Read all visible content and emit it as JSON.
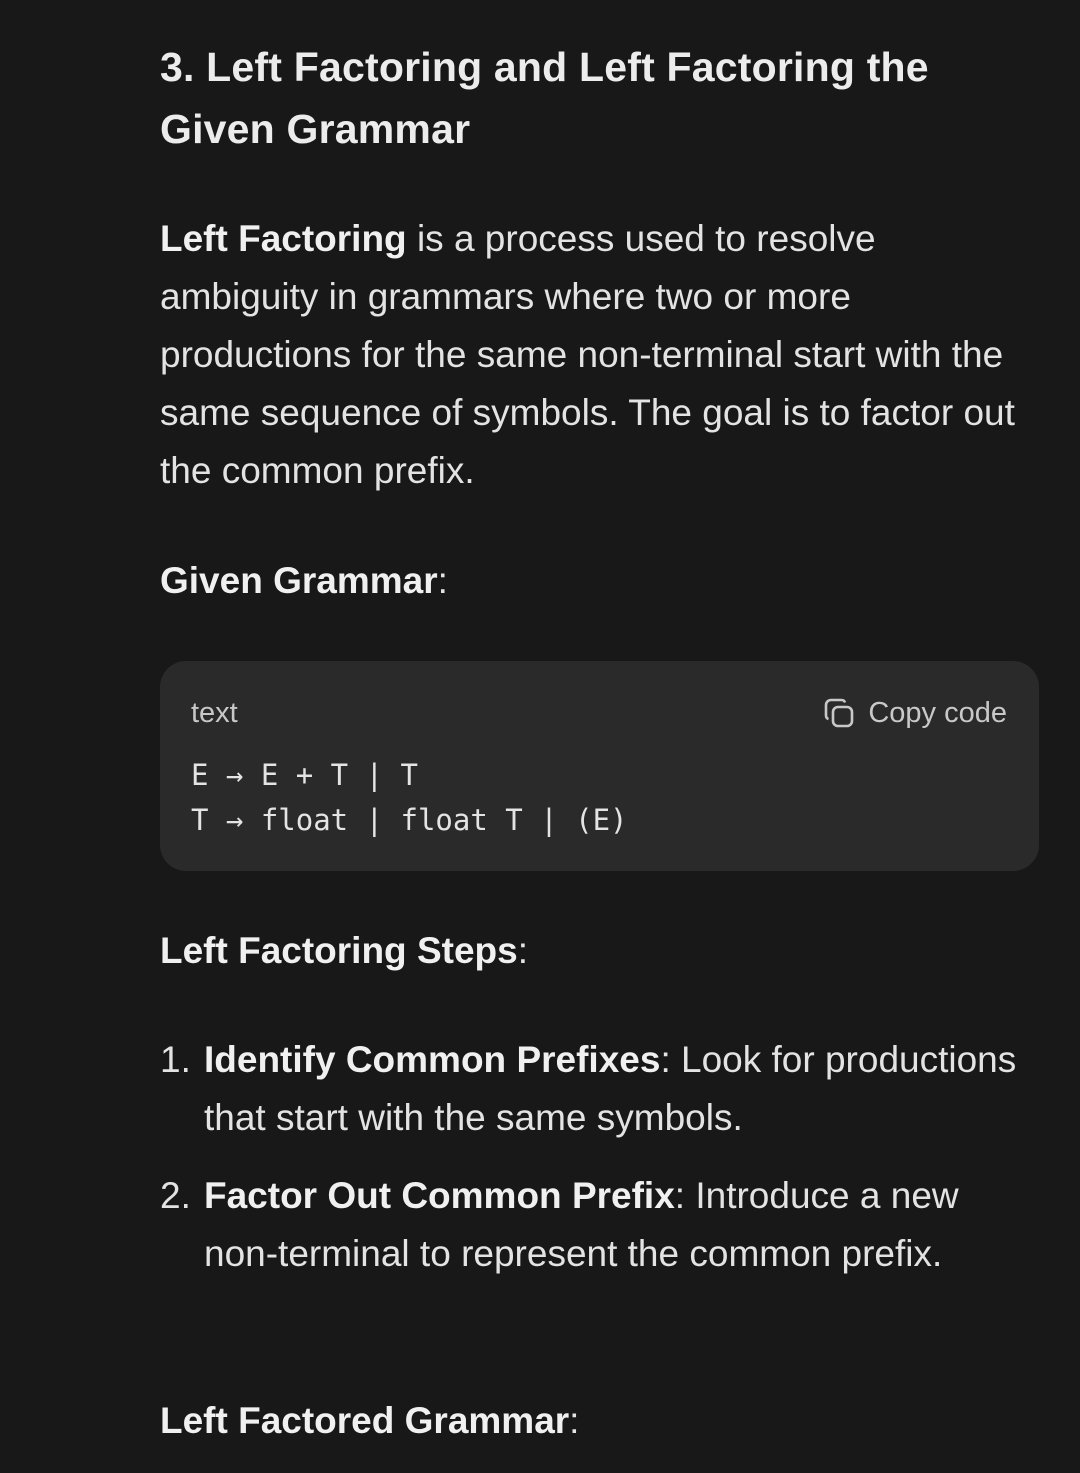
{
  "section": {
    "heading": "3. Left Factoring and Left Factoring the Given Grammar"
  },
  "intro": {
    "term": "Left Factoring",
    "text": " is a process used to resolve ambiguity in grammars where two or more productions for the same non-terminal start with the same sequence of symbols. The goal is to factor out the common prefix."
  },
  "given_grammar": {
    "label": "Given Grammar",
    "colon": ":"
  },
  "code_block": {
    "language": "text",
    "copy_label": "Copy code",
    "copy_icon": "copy-icon",
    "lines": [
      "E → E + T | T",
      "T → float | float T | (E)"
    ]
  },
  "steps_heading": {
    "label": "Left Factoring Steps",
    "colon": ":"
  },
  "steps": [
    {
      "number": "1.",
      "title": "Identify Common Prefixes",
      "text": ": Look for productions that start with the same symbols."
    },
    {
      "number": "2.",
      "title": "Factor Out Common Prefix",
      "text": ": Introduce a new non-terminal to represent the common prefix."
    }
  ],
  "factored_heading": {
    "label": "Left Factored Grammar",
    "colon": ":"
  }
}
